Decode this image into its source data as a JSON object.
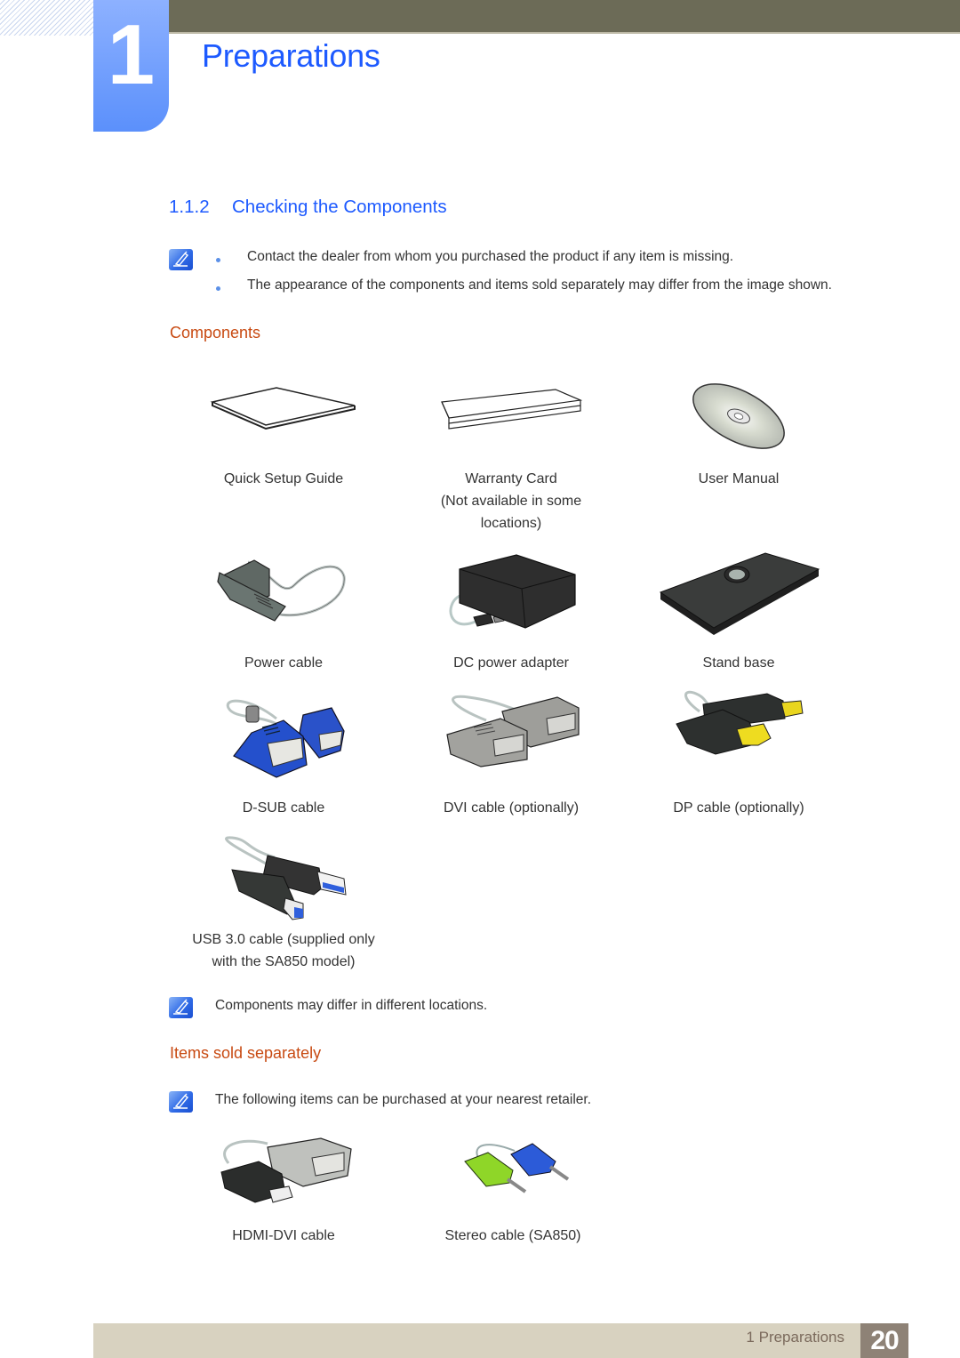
{
  "chapter": {
    "number": "1",
    "title": "Preparations"
  },
  "section": {
    "number": "1.1.2",
    "title": "Checking the Components"
  },
  "intro_notes": [
    "Contact the dealer from whom you purchased the product if any item is missing.",
    "The appearance of the components and items sold separately may differ from the image shown."
  ],
  "components": {
    "heading": "Components",
    "items": [
      {
        "label": "Quick Setup Guide",
        "icon": "quick-setup-guide-booklet"
      },
      {
        "label": "Warranty Card\n(Not available in some\nlocations)",
        "label_lines": [
          "Warranty Card",
          "(Not available in some",
          "locations)"
        ],
        "icon": "warranty-card"
      },
      {
        "label": "User Manual",
        "icon": "cd-disc"
      },
      {
        "label": "Power cable",
        "icon": "power-cable"
      },
      {
        "label": "DC power adapter",
        "icon": "dc-power-adapter"
      },
      {
        "label": "Stand base",
        "icon": "stand-base"
      },
      {
        "label": "D-SUB cable",
        "icon": "d-sub-cable"
      },
      {
        "label": "DVI cable (optionally)",
        "icon": "dvi-cable"
      },
      {
        "label": "DP cable (optionally)",
        "icon": "dp-cable"
      },
      {
        "label_lines": [
          "USB 3.0 cable (supplied only",
          "with the SA850 model)"
        ],
        "icon": "usb3-cable"
      }
    ],
    "note": "Components may differ in different locations."
  },
  "sold_separately": {
    "heading": "Items sold separately",
    "note": "The following items can be purchased at your nearest retailer.",
    "items": [
      {
        "label": "HDMI-DVI cable",
        "icon": "hdmi-dvi-cable"
      },
      {
        "label": "Stereo cable (SA850)",
        "icon": "stereo-cable"
      }
    ]
  },
  "footer": {
    "chapter_label": "1 Preparations",
    "page_number": "20"
  },
  "colors": {
    "accent_blue": "#1d5aff",
    "heading_orange": "#c84a12",
    "header_bar": "#6c6b57",
    "footer_bar": "#d8d2c0",
    "page_badge": "#8e8276"
  }
}
